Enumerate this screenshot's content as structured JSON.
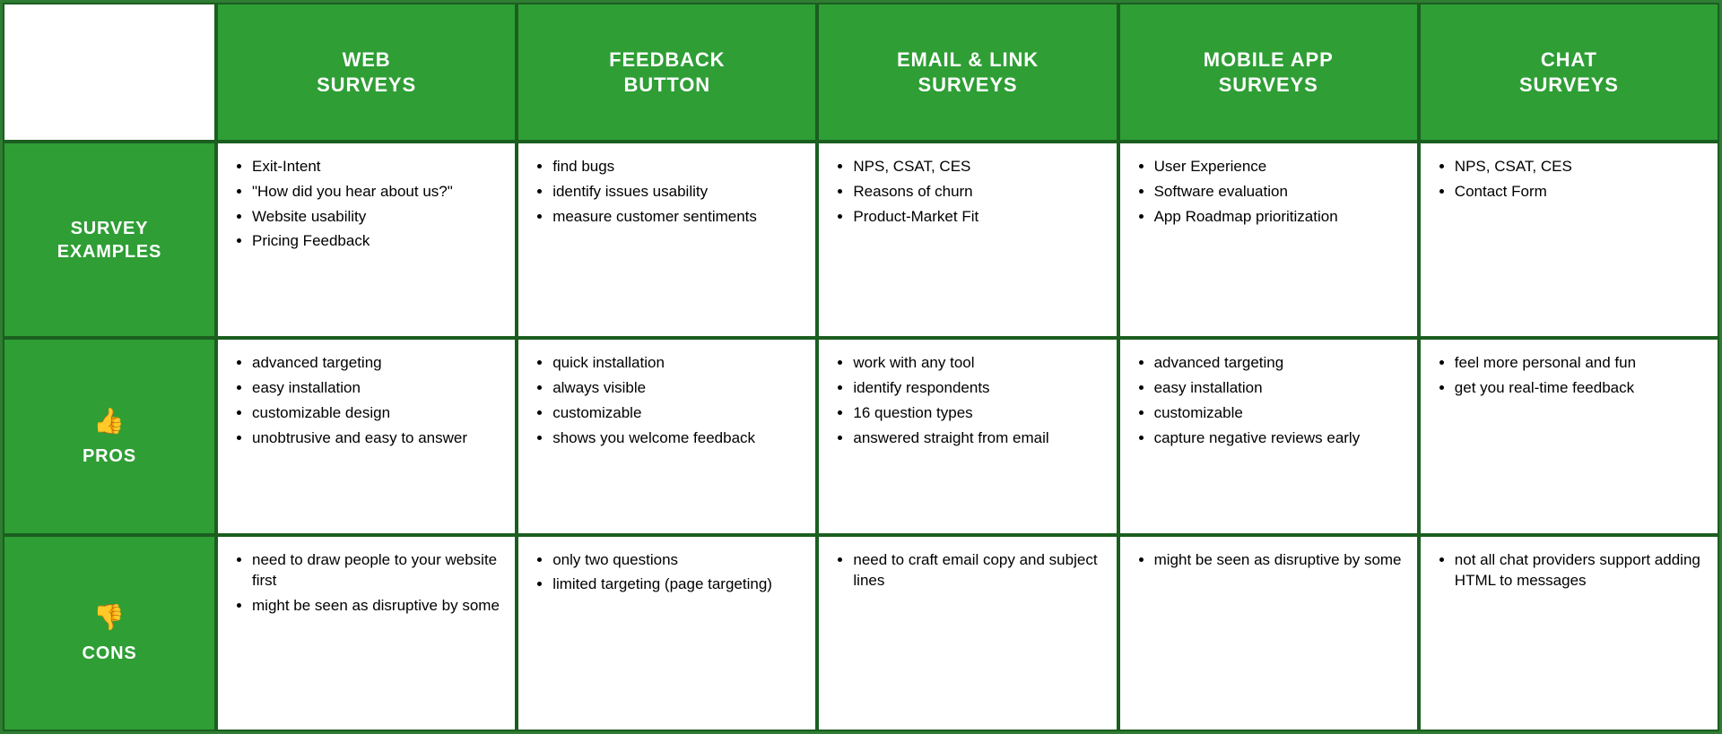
{
  "headers": {
    "empty": "",
    "col1": "WEB\nSURVEYS",
    "col2": "FEEDBACK\nBUTTON",
    "col3": "EMAIL & LINK\nSURVEYS",
    "col4": "MOBILE APP\nSURVEYS",
    "col5": "CHAT\nSURVEYS"
  },
  "rows": [
    {
      "label": "SURVEY\nEXAMPLES",
      "emoji": "",
      "col1": [
        "Exit-Intent",
        "\"How did you hear about us?\"",
        "Website usability",
        "Pricing Feedback"
      ],
      "col2": [
        "find bugs",
        "identify issues usability",
        "measure customer sentiments"
      ],
      "col3": [
        "NPS, CSAT, CES",
        "Reasons of churn",
        "Product-Market Fit"
      ],
      "col4": [
        "User Experience",
        "Software evaluation",
        "App Roadmap prioritization"
      ],
      "col5": [
        "NPS, CSAT, CES",
        "Contact Form"
      ]
    },
    {
      "label": "PROS",
      "emoji": "👍",
      "col1": [
        "advanced targeting",
        "easy installation",
        "customizable design",
        "unobtrusive and easy to answer"
      ],
      "col2": [
        "quick installation",
        "always visible",
        "customizable",
        "shows you welcome feedback"
      ],
      "col3": [
        "work with any tool",
        "identify respondents",
        "16 question types",
        "answered straight from email"
      ],
      "col4": [
        "advanced targeting",
        "easy installation",
        "customizable",
        "capture negative reviews early"
      ],
      "col5": [
        "feel more personal and fun",
        "get you real-time feedback"
      ]
    },
    {
      "label": "CONS",
      "emoji": "👎",
      "col1": [
        "need to draw people to your website first",
        "might be seen as disruptive by some"
      ],
      "col2": [
        "only two questions",
        "limited targeting (page targeting)"
      ],
      "col3": [
        "need to craft email copy and subject lines"
      ],
      "col4": [
        "might be seen as disruptive by some"
      ],
      "col5": [
        "not all chat providers support adding HTML to messages"
      ]
    }
  ]
}
